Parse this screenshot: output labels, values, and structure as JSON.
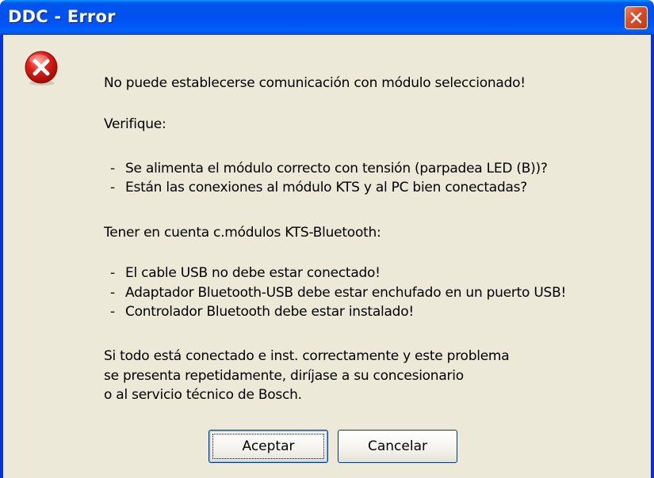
{
  "window": {
    "title": "DDC - Error"
  },
  "dialog": {
    "icon": "error-icon",
    "line1": "No puede establecerse comunicación con módulo seleccionado!",
    "verify_label": "Verifique:",
    "verify_items": [
      "Se alimenta el módulo correcto con tensión (parpadea LED (B))?",
      "Están las conexiones al módulo KTS y al PC bien conectadas?"
    ],
    "bluetooth_label": "Tener en cuenta c.módulos KTS-Bluetooth:",
    "bluetooth_items": [
      "El cable USB no debe estar conectado!",
      "Adaptador Bluetooth-USB debe estar enchufado en un puerto USB!",
      "Controlador Bluetooth debe estar instalado!"
    ],
    "footer_lines": [
      "Si todo está conectado e inst. correctamente y este problema",
      "se presenta repetidamente, diríjase a su concesionario",
      "o al servicio técnico de Bosch."
    ]
  },
  "buttons": {
    "ok_label": "Aceptar",
    "cancel_label": "Cancelar"
  },
  "colors": {
    "titlebar": "#0054e3",
    "client_bg": "#ece9d8",
    "close_button": "#d9502c",
    "error_icon": "#e0211b"
  }
}
